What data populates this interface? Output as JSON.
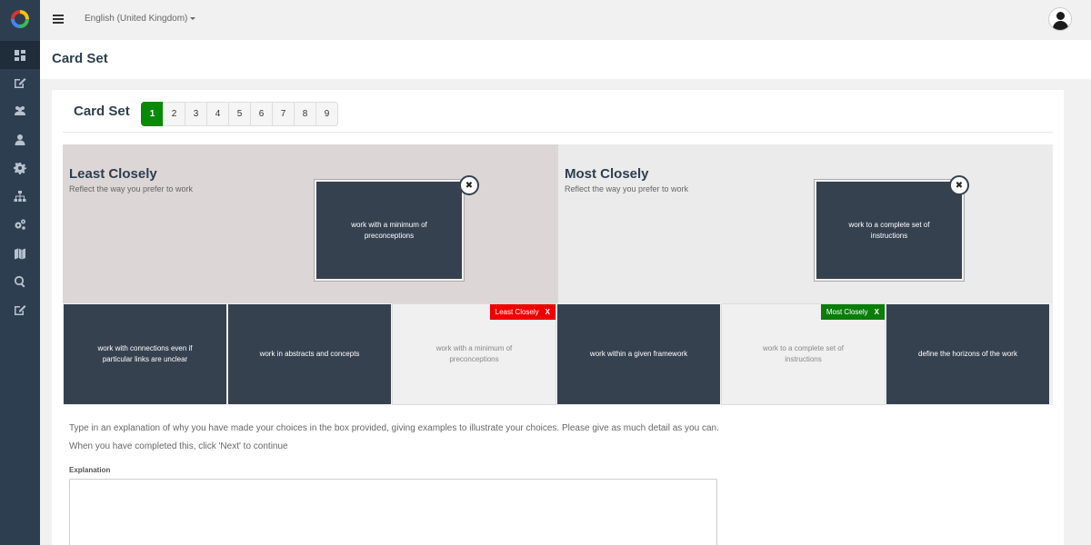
{
  "topbar": {
    "language": "English (United Kingdom)"
  },
  "page": {
    "title": "Card Set"
  },
  "card_set": {
    "title": "Card Set",
    "pages": [
      "1",
      "2",
      "3",
      "4",
      "5",
      "6",
      "7",
      "8",
      "9"
    ],
    "active_page": "1"
  },
  "zones": {
    "least": {
      "title": "Least Closely",
      "subtitle": "Reflect the way you prefer to work",
      "card": "work with a minimum of preconceptions",
      "close": "✖"
    },
    "most": {
      "title": "Most Closely",
      "subtitle": "Reflect the way you prefer to work",
      "card": "work to a complete set of instructions",
      "close": "✖"
    }
  },
  "cards": [
    {
      "text": "work with connections even if particular links are unclear"
    },
    {
      "text": "work in abstracts and concepts"
    },
    {
      "text": "work with a minimum of preconceptions",
      "badge": "Least Closely",
      "badge_x": "X"
    },
    {
      "text": "work within a given framework"
    },
    {
      "text": "work to a complete set of instructions",
      "badge": "Most Closely",
      "badge_x": "X"
    },
    {
      "text": "define the horizons of the work"
    }
  ],
  "instructions": {
    "line1": "Type in an explanation of why you have made your choices in the box provided, giving examples to illustrate your choices. Please give as much detail as you can.",
    "line2": "When you have completed this, click 'Next' to continue"
  },
  "explanation": {
    "label": "Explanation",
    "value": ""
  },
  "colors": {
    "sidebar": "#2d3e50",
    "card": "#364150",
    "active_page": "#088a08",
    "least_badge": "#ee0000",
    "most_badge": "#0a7d0a"
  },
  "icons": [
    "app-logo-icon",
    "dashboard-icon",
    "edit-icon",
    "users-icon",
    "user-icon",
    "settings-icon",
    "hierarchy-icon",
    "cogs-icon",
    "map-icon",
    "search-icon",
    "edit-icon-2"
  ]
}
